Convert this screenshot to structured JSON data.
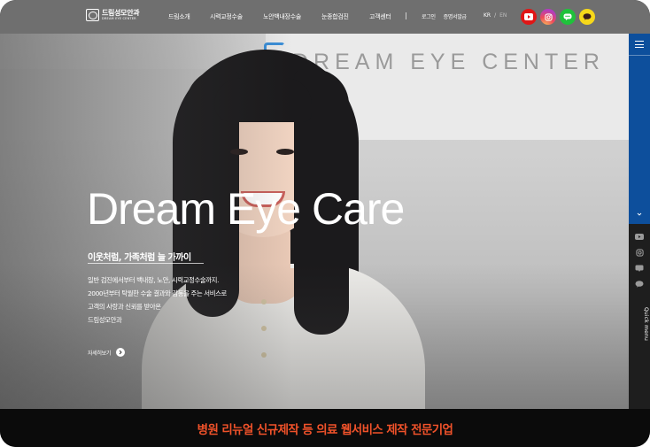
{
  "header": {
    "logo": {
      "name_ko": "드림성모안과",
      "name_en": "DREAM EYE CENTER"
    },
    "menu": [
      "드림소개",
      "시력교정수술",
      "노안백내장수술",
      "눈종합검진",
      "고객센터"
    ],
    "util": [
      "로그인",
      "증명서발급"
    ],
    "lang": {
      "kr": "KR",
      "sep": "/",
      "en": "EN"
    },
    "sns": [
      "youtube-icon",
      "instagram-icon",
      "line-icon",
      "kakaotalk-icon"
    ]
  },
  "hero": {
    "signage": "DREAM EYE CENTER",
    "title": "Dream Eye Care",
    "subtitle": "이웃처럼, 가족처럼 늘 가까이",
    "description": [
      "일반 검진에서부터 백내장, 노안, 시력교정수술까지.",
      "2000년부터 탁월한 수술 결과와 감동을 주는 서비스로",
      "고객의 사랑과 신뢰를 받아온",
      "드림성모안과"
    ],
    "more_label": "자세히보기"
  },
  "quick_menu": {
    "label": "Quick menu",
    "icons": [
      "youtube-icon",
      "instagram-icon",
      "blog-icon",
      "kakaotalk-icon"
    ]
  },
  "banner": {
    "text": "병원 리뉴얼 신규제작 등 의료 웹서비스 제작 전문기업"
  },
  "colors": {
    "header_bg": "#6f6f6f",
    "quick_top": "#0d4f9c",
    "banner_bg": "#0b0b0b",
    "banner_text": "#f0522a",
    "youtube": "#e01616",
    "line": "#1fc23b",
    "kakao": "#f6d81a"
  }
}
